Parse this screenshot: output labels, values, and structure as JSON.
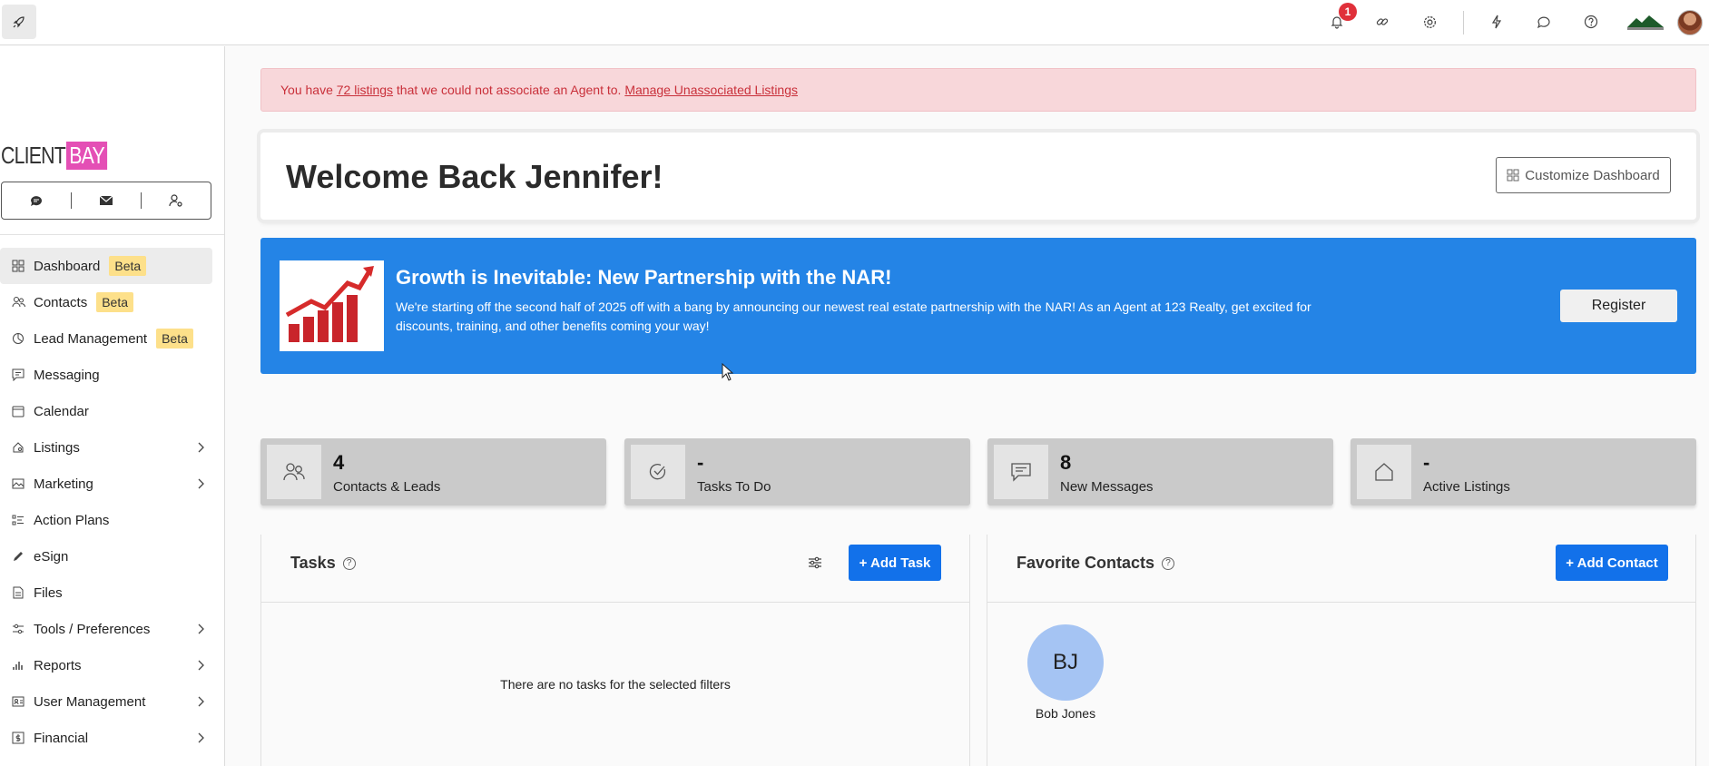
{
  "topbar": {
    "notification_count": "1",
    "icons": [
      "rocket-icon",
      "bell-icon",
      "link-icon",
      "gear-icon",
      "lightning-icon",
      "chat-icon",
      "help-icon"
    ]
  },
  "sidebar": {
    "logo": {
      "client": "CLIENT",
      "bay": "BAY"
    },
    "items": [
      {
        "label": "Dashboard",
        "badge": "Beta",
        "icon": "dashboard-icon"
      },
      {
        "label": "Contacts",
        "badge": "Beta",
        "icon": "contacts-icon"
      },
      {
        "label": "Lead Management",
        "badge": "Beta",
        "icon": "lead-icon"
      },
      {
        "label": "Messaging",
        "icon": "messaging-icon"
      },
      {
        "label": "Calendar",
        "icon": "calendar-icon"
      },
      {
        "label": "Listings",
        "icon": "listings-icon"
      },
      {
        "label": "Marketing",
        "icon": "marketing-icon"
      },
      {
        "label": "Action Plans",
        "icon": "action-plans-icon"
      },
      {
        "label": "eSign",
        "icon": "pen-icon"
      },
      {
        "label": "Files",
        "icon": "file-icon"
      },
      {
        "label": "Tools / Preferences",
        "icon": "tools-icon"
      },
      {
        "label": "Reports",
        "icon": "reports-icon"
      },
      {
        "label": "User Management",
        "icon": "user-management-icon"
      },
      {
        "label": "Financial",
        "icon": "financial-icon"
      }
    ]
  },
  "alert": {
    "prefix": "You have ",
    "link_listings": "72 listings",
    "middle": " that we could not associate an Agent to. ",
    "link_manage": "Manage Unassociated Listings"
  },
  "welcome": {
    "title": "Welcome Back Jennifer!",
    "customize_label": "Customize Dashboard"
  },
  "banner": {
    "title": "Growth is Inevitable: New Partnership with the NAR!",
    "body": "We're starting off the second half of 2025 off with a bang by announcing our newest real estate partnership with the NAR! As an Agent at 123 Realty, get excited for discounts, training, and other benefits coming your way!",
    "button": "Register",
    "colors": {
      "background": "#2484e6"
    }
  },
  "stats": [
    {
      "value": "4",
      "label": "Contacts & Leads",
      "icon": "contacts-icon"
    },
    {
      "value": "-",
      "label": "Tasks To Do",
      "icon": "check-circle-icon"
    },
    {
      "value": "8",
      "label": "New Messages",
      "icon": "message-icon"
    },
    {
      "value": "-",
      "label": "Active Listings",
      "icon": "home-icon"
    }
  ],
  "tasks": {
    "title": "Tasks",
    "add_label": "+ Add Task",
    "empty": "There are no tasks for the selected filters"
  },
  "favorites": {
    "title": "Favorite Contacts",
    "add_label": "+ Add Contact",
    "contacts": [
      {
        "initials": "BJ",
        "name": "Bob Jones"
      }
    ]
  },
  "colors": {
    "accent": "#1271ea",
    "alert_bg": "#f8d7da",
    "alert_text": "#c9303a",
    "beta_badge": "#fde08a",
    "logo_pink": "#e44fb5"
  }
}
